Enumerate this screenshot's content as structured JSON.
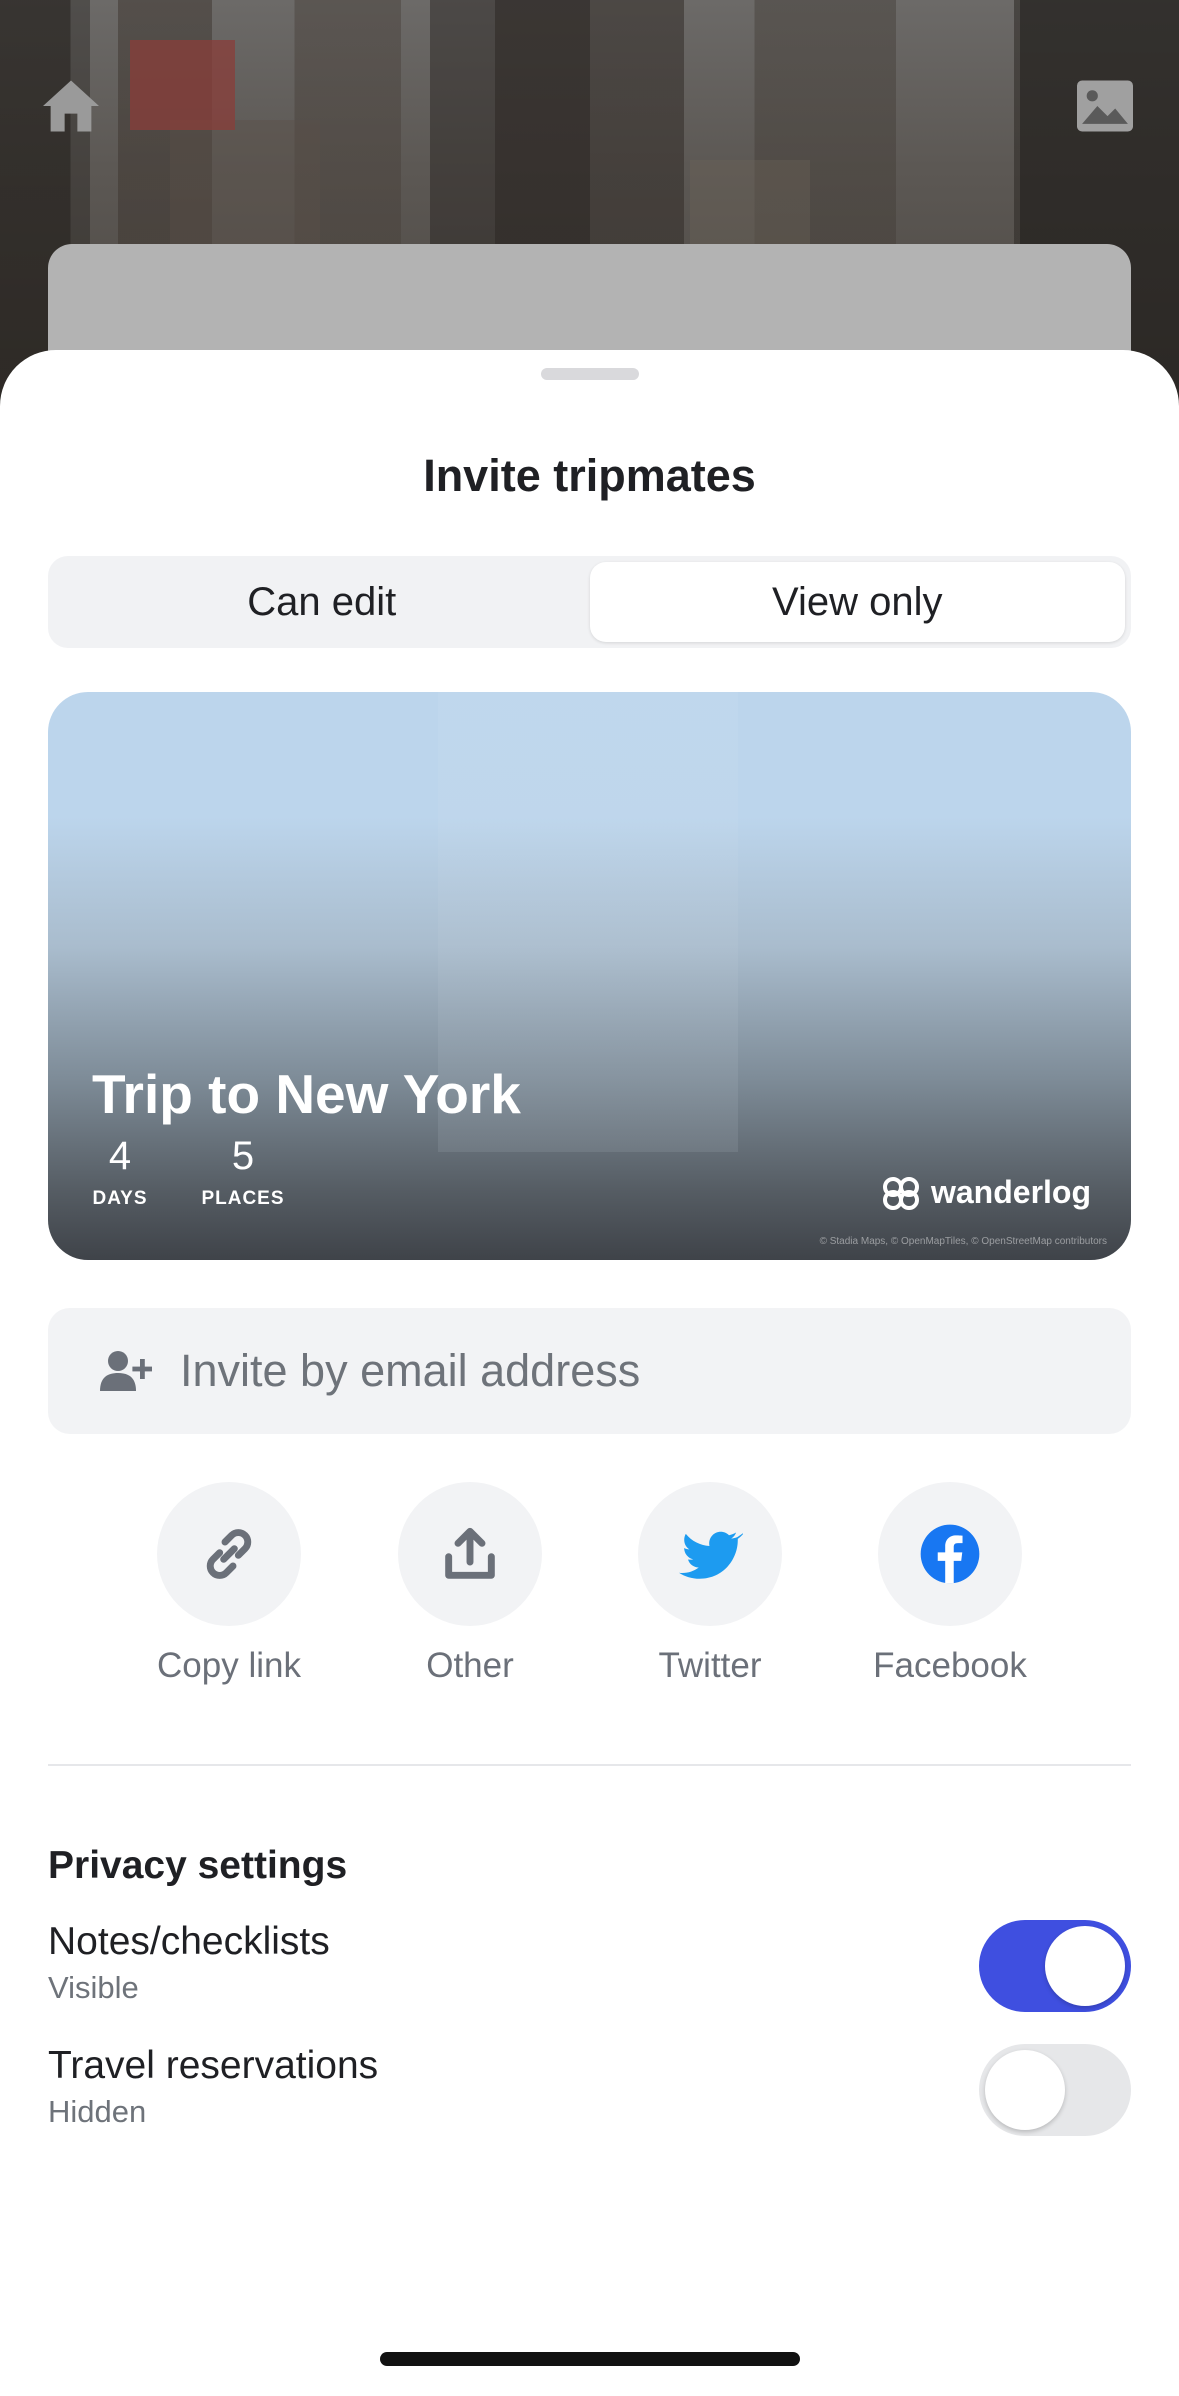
{
  "background": {
    "top_left_icon": "home-icon",
    "top_right_icon": "image-icon"
  },
  "sheet": {
    "title": "Invite tripmates",
    "segments": [
      {
        "label": "Can edit",
        "selected": false
      },
      {
        "label": "View only",
        "selected": true
      }
    ]
  },
  "trip_card": {
    "title": "Trip to New York",
    "days_value": "4",
    "days_label": "DAYS",
    "places_value": "5",
    "places_label": "PLACES",
    "brand": "wanderlog",
    "attribution": "© Stadia Maps, © OpenMapTiles, © OpenStreetMap contributors"
  },
  "invite": {
    "placeholder": "Invite by email address",
    "icon": "add-person-icon"
  },
  "share_options": [
    {
      "label": "Copy link",
      "icon": "link-icon"
    },
    {
      "label": "Other",
      "icon": "upload-share-icon"
    },
    {
      "label": "Twitter",
      "icon": "twitter-icon"
    },
    {
      "label": "Facebook",
      "icon": "facebook-icon"
    }
  ],
  "privacy": {
    "title": "Privacy settings",
    "settings": [
      {
        "name": "Notes/checklists",
        "status": "Visible",
        "enabled": true
      },
      {
        "name": "Travel reservations",
        "status": "Hidden",
        "enabled": false
      }
    ]
  },
  "colors": {
    "toggle_on": "#3f4fe0",
    "twitter": "#1d9bf0",
    "facebook": "#1877f2"
  }
}
